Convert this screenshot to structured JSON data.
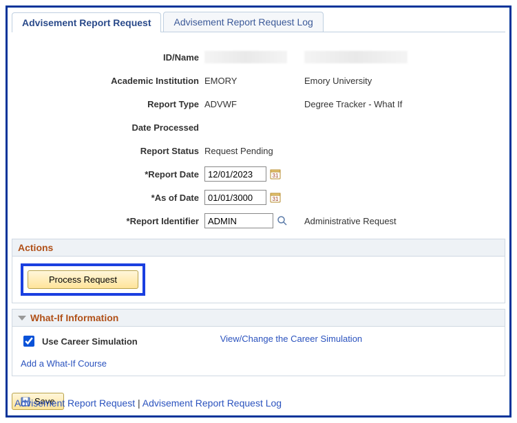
{
  "tabs": {
    "advisement": "Advisement Report Request",
    "log": "Advisement Report Request Log"
  },
  "labels": {
    "id_name": "ID/Name",
    "institution": "Academic Institution",
    "report_type": "Report Type",
    "date_processed": "Date Processed",
    "report_status": "Report Status",
    "report_date": "*Report Date",
    "as_of_date": "*As of Date",
    "report_identifier": "*Report Identifier"
  },
  "values": {
    "institution_code": "EMORY",
    "institution_name": "Emory University",
    "report_type_code": "ADVWF",
    "report_type_name": "Degree Tracker - What If",
    "report_status": "Request Pending",
    "report_date": "12/01/2023",
    "as_of_date": "01/01/3000",
    "report_identifier": "ADMIN",
    "report_identifier_desc": "Administrative Request"
  },
  "sections": {
    "actions_title": "Actions",
    "whatif_title": "What-If Information"
  },
  "buttons": {
    "process_request": "Process Request",
    "save": "Save"
  },
  "whatif": {
    "use_career_sim": "Use Career Simulation",
    "view_change_sim": "View/Change the Career Simulation",
    "add_course": "Add a What-If Course",
    "checked": true
  },
  "footer": {
    "link1": "Advisement Report Request",
    "sep": " | ",
    "link2": "Advisement Report Request Log"
  }
}
